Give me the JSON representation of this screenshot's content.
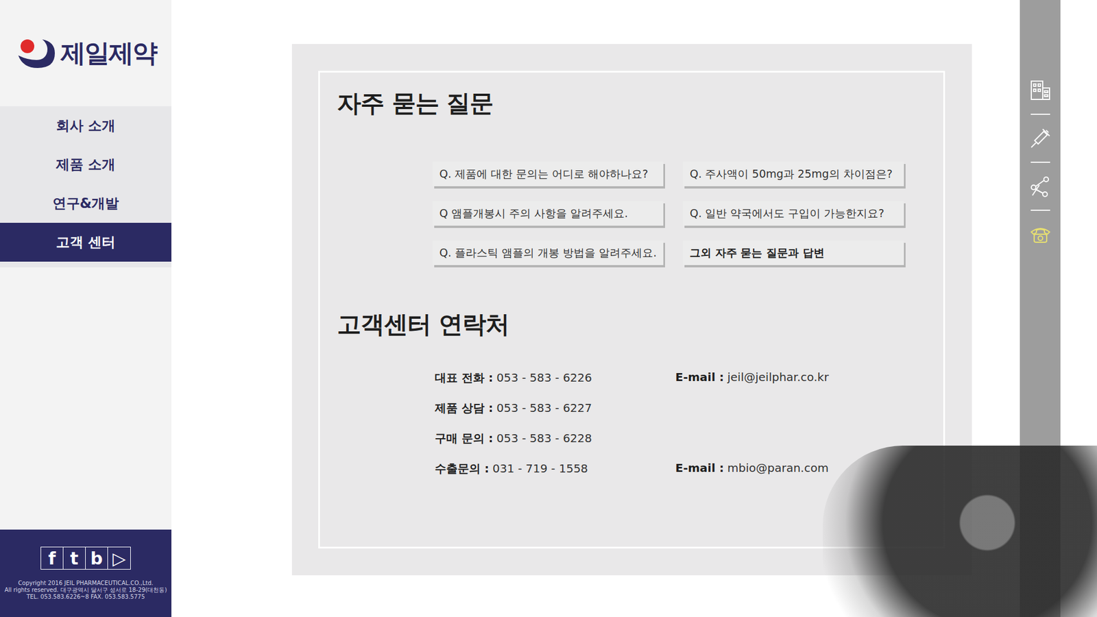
{
  "sidebar": {
    "logo": "제일제약",
    "items": [
      {
        "label": "회사 소개",
        "selected": false
      },
      {
        "label": "제품 소개",
        "selected": false
      },
      {
        "label": "연구&개발",
        "selected": false
      },
      {
        "label": "고객 센터",
        "selected": true
      }
    ],
    "social": [
      {
        "label": "f"
      },
      {
        "label": "t"
      },
      {
        "label": "b"
      },
      {
        "label": "▷"
      }
    ],
    "copyright": [
      "Copyright 2016 JEIL PHARMACEUTICAL.CO.,Ltd.",
      "All rights reserved. 대구광역시 달서구 성서로 18-29(대천동)",
      "TEL. 053.583.6226~8 FAX. 053.583.5775"
    ]
  },
  "faq": {
    "title": "자주 묻는 질문",
    "items": [
      {
        "label": "Q. 제품에 대한 문의는 어디로 해야하나요?",
        "emphasis": false
      },
      {
        "label": "Q. 주사액이 50mg과 25mg의 차이점은?",
        "emphasis": false
      },
      {
        "label": "Q 앰플개봉시 주의 사항을 알려주세요.",
        "emphasis": false
      },
      {
        "label": "Q. 일반 약국에서도 구입이 가능한지요?",
        "emphasis": false
      },
      {
        "label": "Q. 플라스틱 앰플의 개봉 방법을 알려주세요.",
        "emphasis": false
      },
      {
        "label": "그외 자주 묻는 질문과 답변",
        "emphasis": true
      }
    ]
  },
  "contact": {
    "title": "고객센터 연락처",
    "rows": [
      {
        "label": "대표 전화 :",
        "value": "053 - 583 - 6226",
        "email_label": "E-mail :",
        "email": "jeil@jeilphar.co.kr"
      },
      {
        "label": "제품 상담 :",
        "value": "053 - 583 - 6227",
        "email_label": null,
        "email": null
      },
      {
        "label": "구매 문의 :",
        "value": "053 - 583 - 6228",
        "email_label": null,
        "email": null
      },
      {
        "label": "수출문의 :",
        "value": "031 - 719 - 1558",
        "email_label": "E-mail :",
        "email": "mbio@paran.com"
      }
    ]
  },
  "rail": [
    {
      "icon": "building",
      "selected": false
    },
    {
      "icon": "syringe",
      "selected": false
    },
    {
      "icon": "molecule",
      "selected": false
    },
    {
      "icon": "phone",
      "selected": true
    }
  ]
}
